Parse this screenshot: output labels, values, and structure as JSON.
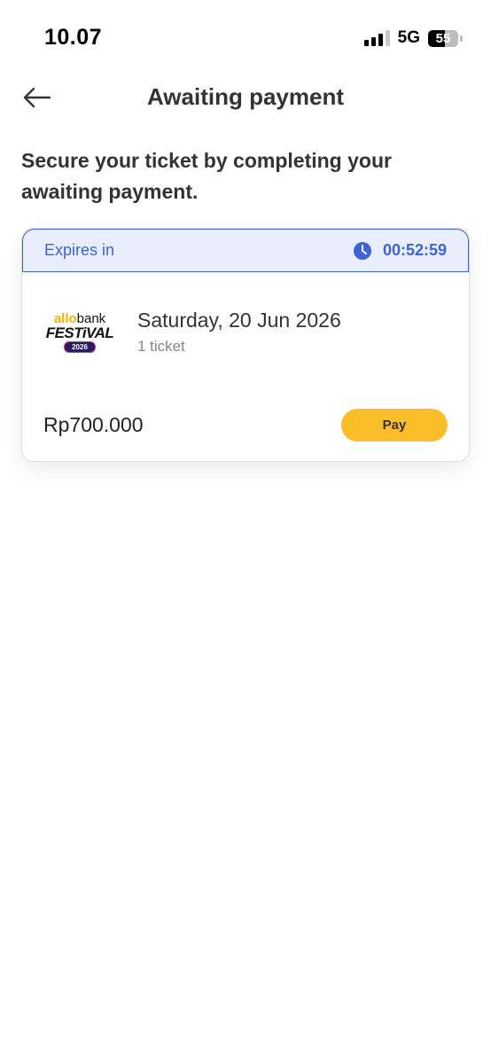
{
  "status_bar": {
    "time": "10.07",
    "network": "5G",
    "battery": "55"
  },
  "header": {
    "title": "Awaiting payment",
    "back_icon": "arrow-left-icon"
  },
  "intro_text": "Secure your ticket by completing your awaiting payment.",
  "card": {
    "expires_label": "Expires in",
    "timer": "00:52:59",
    "timer_icon": "clock-icon",
    "event": {
      "logo": {
        "allo": "allo",
        "bank": "bank",
        "festival": "FESTiVAL",
        "year": "2026"
      },
      "date": "Saturday, 20 Jun 2026",
      "tickets": "1 ticket"
    },
    "price": "Rp700.000",
    "pay_label": "Pay"
  },
  "colors": {
    "accent_blue": "#3d63d6",
    "expires_bg": "#e8eefc",
    "pay_yellow": "#fbbd29"
  }
}
